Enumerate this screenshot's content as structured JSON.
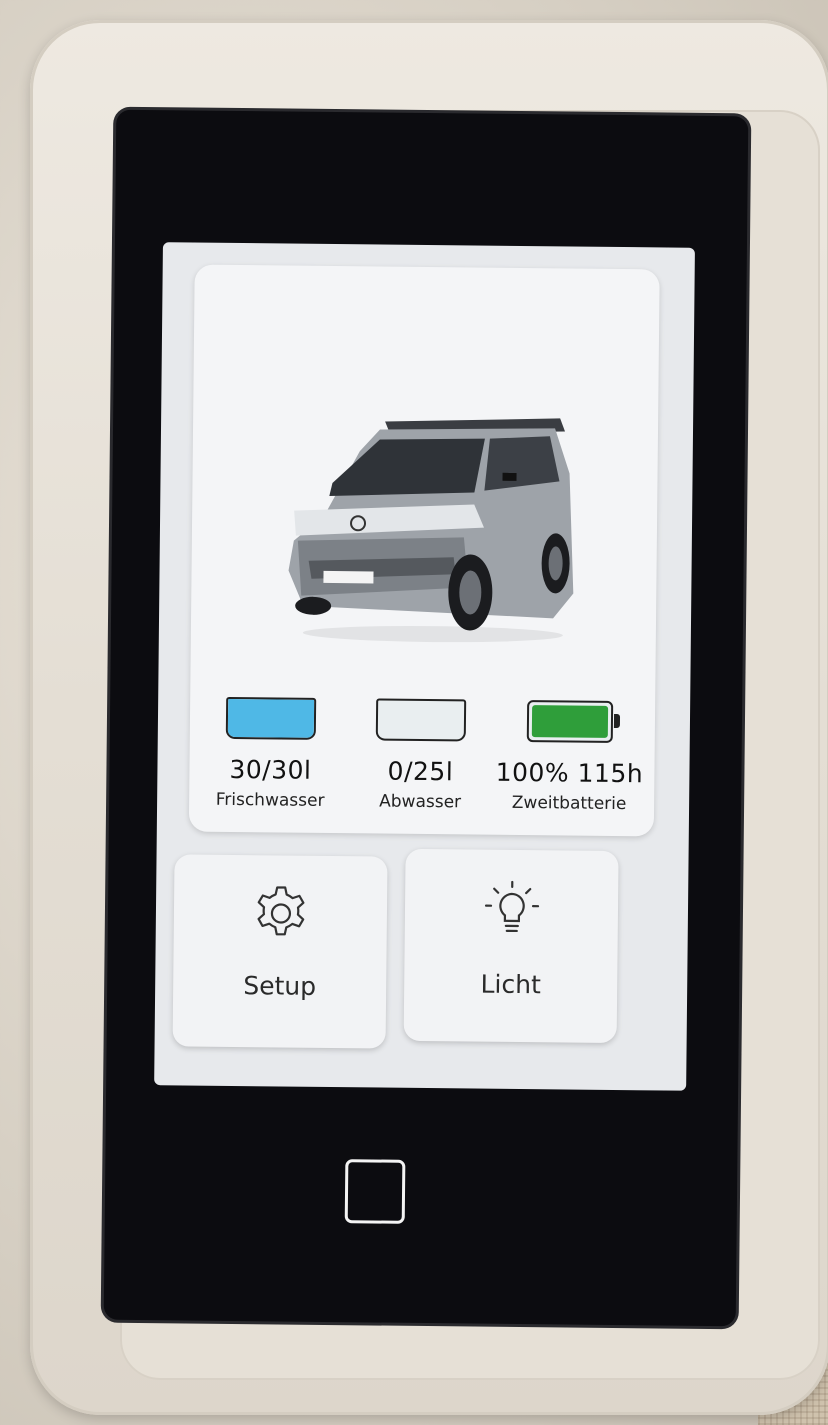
{
  "colors": {
    "fresh_water": "#4fb8e6",
    "waste_water": "#e9eef0",
    "battery": "#2f9e3a"
  },
  "gauges": [
    {
      "icon": "fresh-water-tank-icon",
      "value": "30/30l",
      "label": "Frischwasser",
      "fill_fraction": 1.0
    },
    {
      "icon": "waste-water-tank-icon",
      "value": "0/25l",
      "label": "Abwasser",
      "fill_fraction": 0.0
    },
    {
      "icon": "battery-icon",
      "value": "100% 115h",
      "label": "Zweitbatterie",
      "fill_fraction": 1.0
    }
  ],
  "tiles": {
    "setup": {
      "label": "Setup",
      "icon": "gear-icon"
    },
    "licht": {
      "label": "Licht",
      "icon": "lightbulb-icon"
    }
  }
}
